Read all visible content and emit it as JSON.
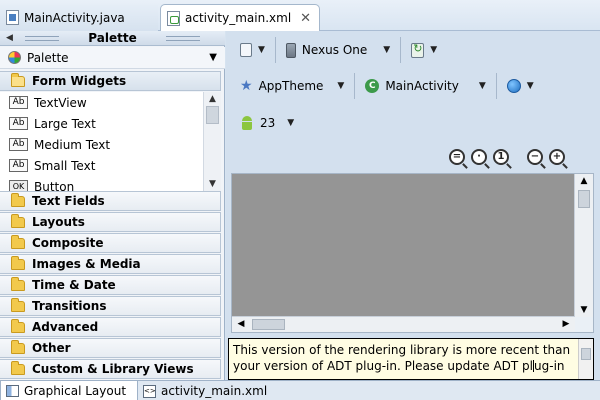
{
  "editor_tabs": [
    {
      "label": "MainActivity.java",
      "icon": "java-file-icon"
    },
    {
      "label": "activity_main.xml",
      "icon": "xml-file-icon",
      "close": "✕"
    }
  ],
  "palette": {
    "header": "Palette",
    "dropdown_label": "Palette",
    "open_category": "Form Widgets",
    "widgets": [
      "TextView",
      "Large Text",
      "Medium Text",
      "Small Text",
      "Button"
    ],
    "categories": [
      "Text Fields",
      "Layouts",
      "Composite",
      "Images & Media",
      "Time & Date",
      "Transitions",
      "Advanced",
      "Other",
      "Custom & Library Views"
    ]
  },
  "toolbar": {
    "device": "Nexus One",
    "theme": "AppTheme",
    "activity": "MainActivity",
    "api_level": "23"
  },
  "zoom_buttons": [
    "zoom-fit-icon",
    "zoom-real-icon",
    "zoom-100-icon",
    "zoom-out-icon",
    "zoom-in-icon"
  ],
  "error_message": {
    "line1": "This version of the rendering library is more recent than",
    "line2_before_cursor": "your version of ADT plug-in. Please update ADT pl",
    "line2_after_cursor": "ug-in"
  },
  "bottom_tabs": [
    {
      "label": "Graphical Layout",
      "icon": "layout-icon"
    },
    {
      "label": "activity_main.xml",
      "icon": "xml-source-icon"
    }
  ]
}
